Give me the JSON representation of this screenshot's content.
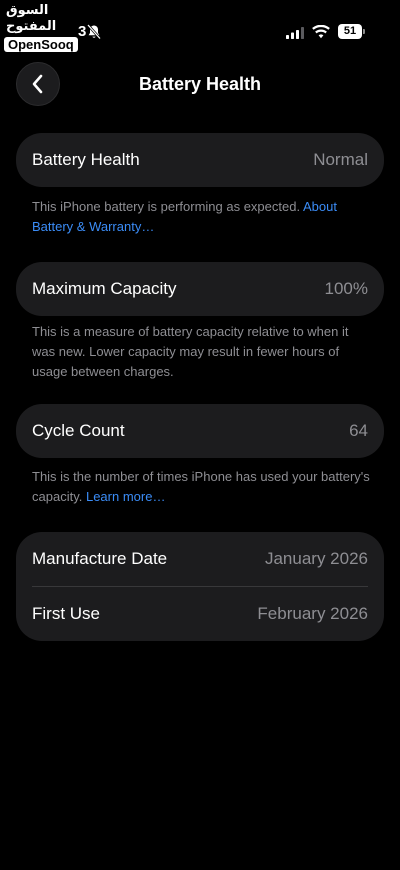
{
  "watermark": {
    "arabic": "السوق المفتوح",
    "brand": "OpenSooq"
  },
  "status_bar": {
    "time_fragment": "3",
    "battery_level": "51"
  },
  "header": {
    "title": "Battery Health"
  },
  "sections": {
    "battery_health": {
      "label": "Battery Health",
      "value": "Normal",
      "footnote": "This iPhone battery is performing as expected.",
      "link": "About Battery & Warranty…"
    },
    "maximum_capacity": {
      "label": "Maximum Capacity",
      "value": "100%",
      "footnote": "This is a measure of battery capacity relative to when it was new. Lower capacity may result in fewer hours of usage between charges."
    },
    "cycle_count": {
      "label": "Cycle Count",
      "value": "64",
      "footnote": "This is the number of times iPhone has used your battery's capacity.",
      "link": "Learn more…"
    },
    "dates": {
      "manufacture_label": "Manufacture Date",
      "manufacture_value": "January 2026",
      "first_use_label": "First Use",
      "first_use_value": "February 2026"
    }
  },
  "colors": {
    "background": "#000000",
    "card": "#1c1c1e",
    "secondary_text": "#8e8e93",
    "link": "#3b8cf6"
  }
}
